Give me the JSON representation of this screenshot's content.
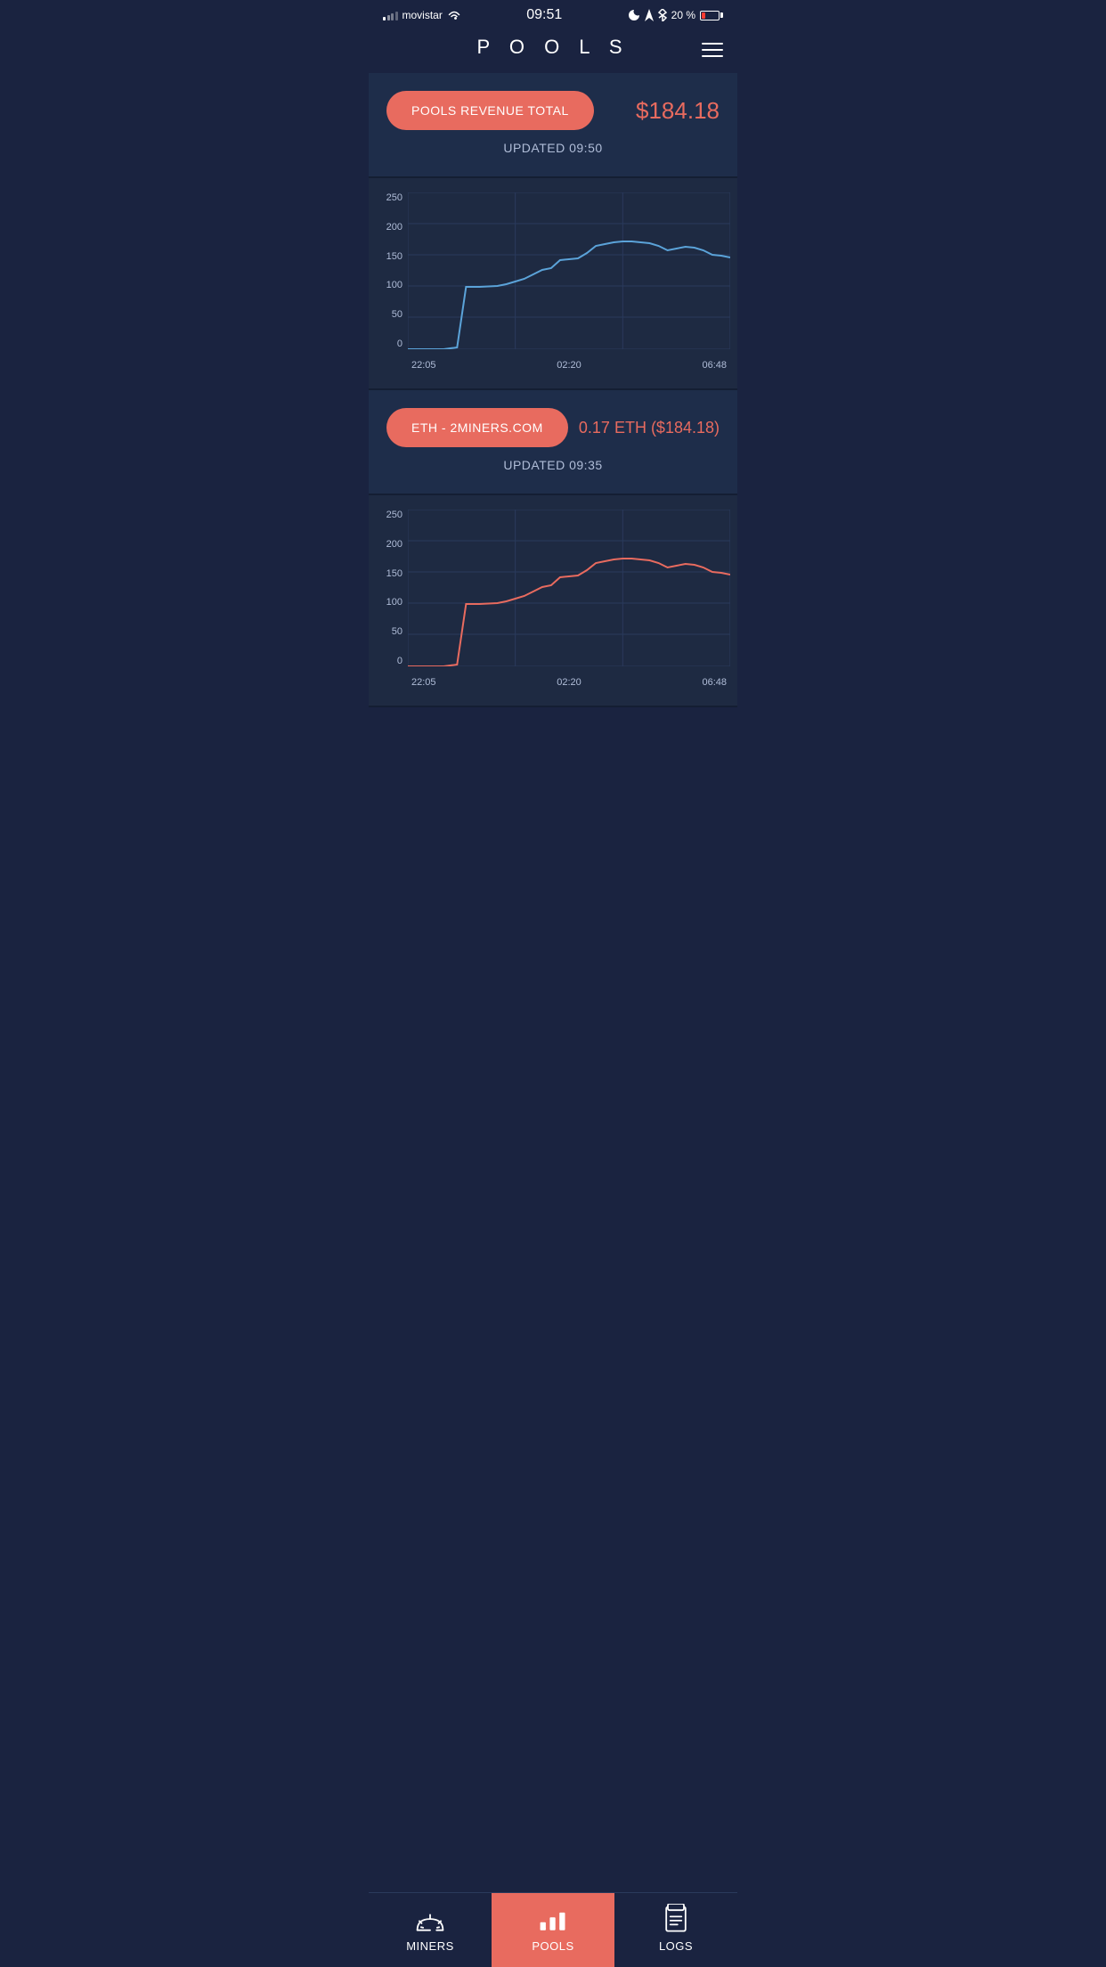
{
  "status_bar": {
    "carrier": "movistar",
    "time": "09:51",
    "battery_percent": "20 %"
  },
  "header": {
    "title": "P O O L S",
    "menu_label": "menu"
  },
  "pools_revenue": {
    "button_label": "POOLS REVENUE TOTAL",
    "value": "$184.18",
    "updated_label": "UPDATED 09:50"
  },
  "chart1": {
    "y_labels": [
      "250",
      "200",
      "150",
      "100",
      "50",
      "0"
    ],
    "x_labels": [
      "22:05",
      "02:20",
      "06:48"
    ],
    "color": "blue"
  },
  "eth_pool": {
    "button_label": "ETH - 2MINERS.COM",
    "value": "0.17 ETH ($184.18)",
    "updated_label": "UPDATED 09:35"
  },
  "chart2": {
    "y_labels": [
      "250",
      "200",
      "150",
      "100",
      "50",
      "0"
    ],
    "x_labels": [
      "22:05",
      "02:20",
      "06:48"
    ],
    "color": "red"
  },
  "nav": {
    "items": [
      {
        "label": "MINERS",
        "icon": "miners-icon",
        "active": false
      },
      {
        "label": "POOLS",
        "icon": "pools-icon",
        "active": true
      },
      {
        "label": "LOGS",
        "icon": "logs-icon",
        "active": false
      }
    ]
  }
}
